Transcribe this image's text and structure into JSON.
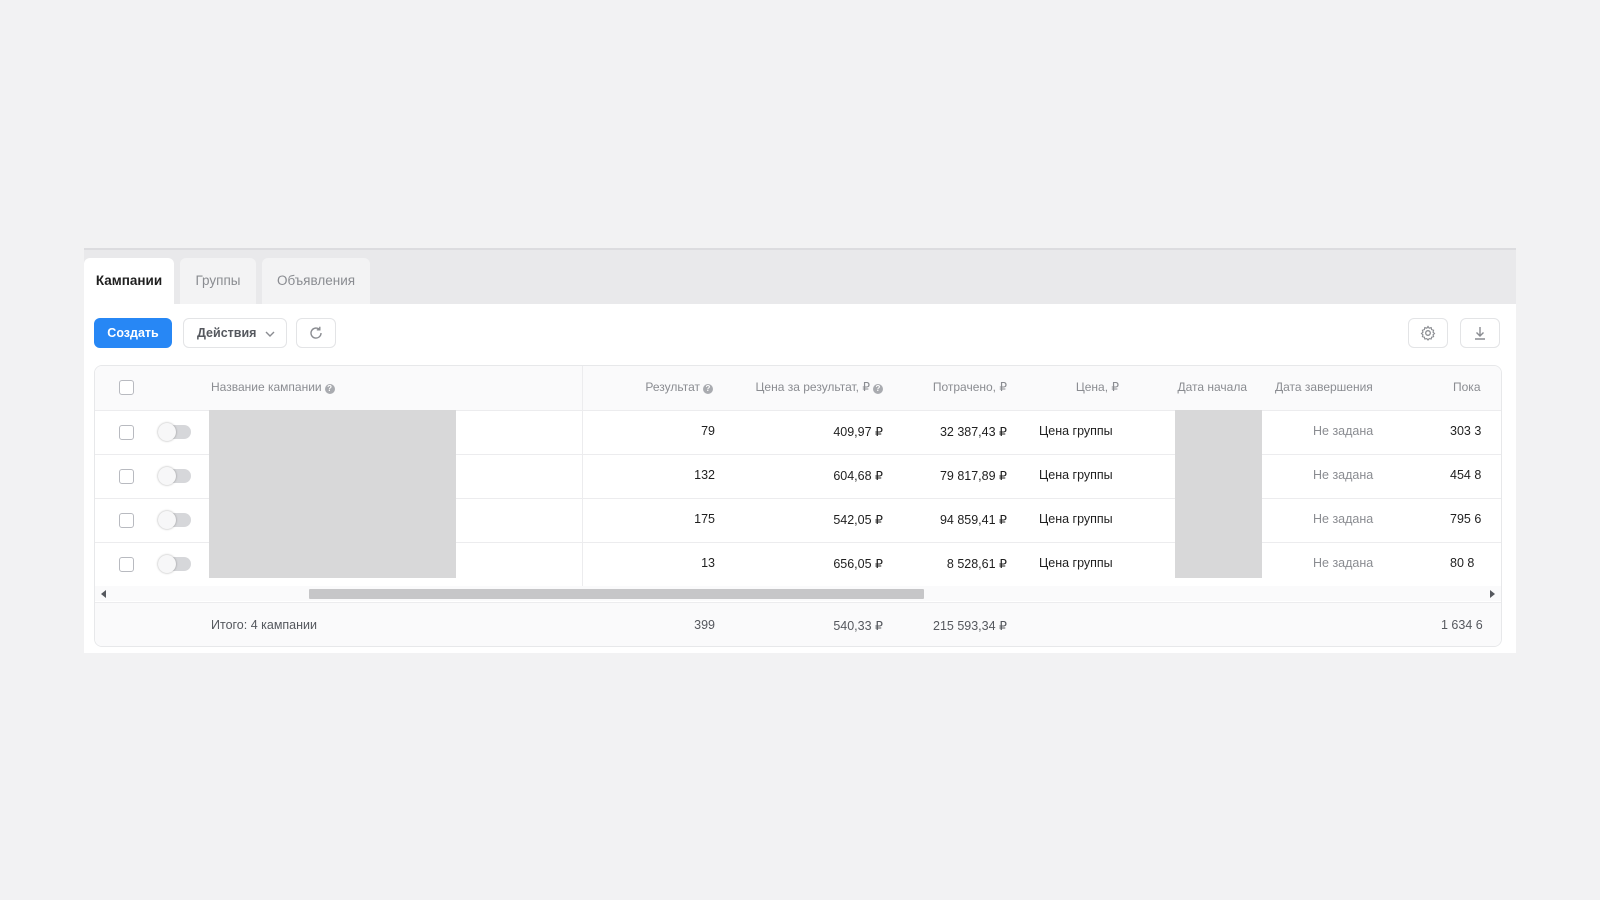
{
  "tabs": [
    "Кампании",
    "Группы",
    "Объявления"
  ],
  "toolbar": {
    "create_label": "Создать",
    "actions_label": "Действия",
    "refresh_icon": "refresh-icon",
    "settings_icon": "gear-icon",
    "download_icon": "download-icon"
  },
  "table": {
    "headers": {
      "name": "Название кампании",
      "result": "Результат",
      "price_per_result": "Цена за результат, ₽",
      "spent": "Потрачено, ₽",
      "price": "Цена, ₽",
      "start_date": "Дата начала",
      "end_date": "Дата завершения",
      "impressions": "Пока"
    },
    "rows": [
      {
        "result": "79",
        "price_per_result": "409,97 ₽",
        "spent": "32 387,43 ₽",
        "price": "Цена группы",
        "end_date": "Не задана",
        "impressions": "303 3"
      },
      {
        "result": "132",
        "price_per_result": "604,68 ₽",
        "spent": "79 817,89 ₽",
        "price": "Цена группы",
        "end_date": "Не задана",
        "impressions": "454 8"
      },
      {
        "result": "175",
        "price_per_result": "542,05 ₽",
        "spent": "94 859,41 ₽",
        "price": "Цена группы",
        "end_date": "Не задана",
        "impressions": "795 6"
      },
      {
        "result": "13",
        "price_per_result": "656,05 ₽",
        "spent": "8 528,61 ₽",
        "price": "Цена группы",
        "end_date": "Не задана",
        "impressions": "80 8"
      }
    ],
    "totals": {
      "label": "Итого: 4 кампании",
      "result": "399",
      "price_per_result": "540,33 ₽",
      "spent": "215 593,34 ₽",
      "impressions": "1 634 6"
    }
  },
  "colors": {
    "accent": "#2787f5",
    "redacted": "#d8d8d9"
  }
}
